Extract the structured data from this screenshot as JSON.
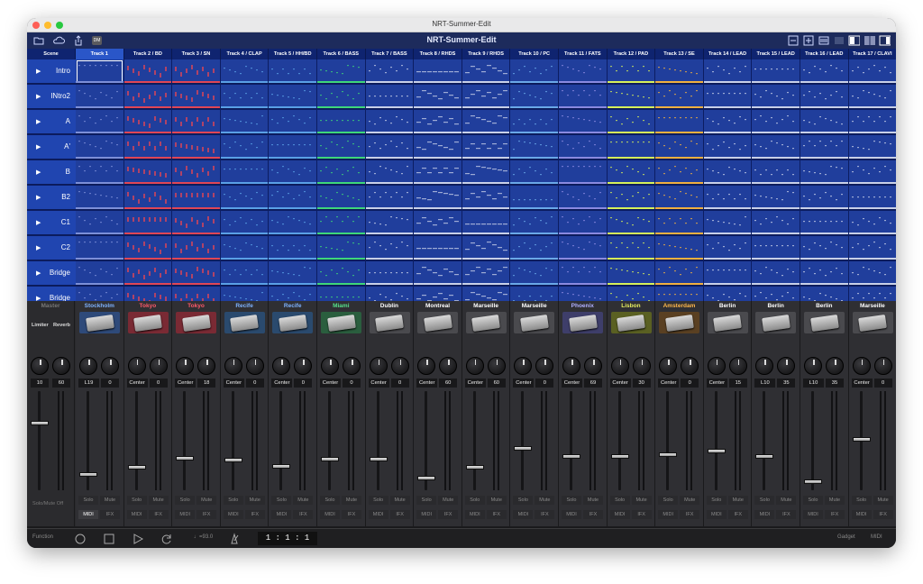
{
  "window": {
    "title": "NRT-Summer-Edit"
  },
  "toolbar": {
    "title": "NRT-Summer-Edit",
    "badge": "DM"
  },
  "header": {
    "scene_label": "Scene"
  },
  "tracks": [
    {
      "label": "Track 1",
      "color": "#7c8fd8"
    },
    {
      "label": "Track 2 / BD",
      "color": "#e04656"
    },
    {
      "label": "Track 3 / SN",
      "color": "#e04656"
    },
    {
      "label": "Track 4 / CLAP",
      "color": "#5aa0e6"
    },
    {
      "label": "Track 5 / HH/BD",
      "color": "#5aa0e6"
    },
    {
      "label": "Track 6 / BASS",
      "color": "#3ed77a"
    },
    {
      "label": "Track 7 / BASS",
      "color": "#c8d0e8"
    },
    {
      "label": "Track 8 / RHDS",
      "color": "#c8d0e8"
    },
    {
      "label": "Track 9 / RHDS",
      "color": "#c8d0e8"
    },
    {
      "label": "Track 10 / PC",
      "color": "#6aa8e8"
    },
    {
      "label": "Track 11 / FATS",
      "color": "#8a8ae0"
    },
    {
      "label": "Track 12 / PAD",
      "color": "#d6f05a"
    },
    {
      "label": "Track 13 / SE",
      "color": "#f0b040"
    },
    {
      "label": "Track 14 / LEAD",
      "color": "#c8d0e8"
    },
    {
      "label": "Track 15 / LEAD",
      "color": "#c8d0e8"
    },
    {
      "label": "Track 16 / LEAD",
      "color": "#c8d0e8"
    },
    {
      "label": "Track 17 / CLAVI",
      "color": "#c8d0e8"
    }
  ],
  "scenes": [
    "Intro",
    "INtro2",
    "A",
    "A'",
    "B",
    "B2",
    "C1",
    "C2",
    "Bridge",
    "Bridge"
  ],
  "mixer": {
    "master": {
      "label": "Master",
      "limiter": "Limiter",
      "reverb": "Reverb",
      "values": [
        "10",
        "60"
      ],
      "solo_mute_off": "Solo/Mute Off",
      "level": 0.68
    },
    "channels": [
      {
        "name": "Stockholm",
        "color": "#7fb3ff",
        "inst_bg": "#2e4a7a",
        "pan": "L19",
        "send": "0",
        "level": 0.16
      },
      {
        "name": "Tokyo",
        "color": "#ff5a6a",
        "inst_bg": "#7a2a34",
        "pan": "Center",
        "send": "0",
        "level": 0.24
      },
      {
        "name": "Tokyo",
        "color": "#ff5a6a",
        "inst_bg": "#7a2a34",
        "pan": "Center",
        "send": "18",
        "level": 0.33
      },
      {
        "name": "Recife",
        "color": "#7fb3ff",
        "inst_bg": "#2a4a6e",
        "pan": "Center",
        "send": "0",
        "level": 0.31
      },
      {
        "name": "Recife",
        "color": "#7fb3ff",
        "inst_bg": "#2a4a6e",
        "pan": "Center",
        "send": "0",
        "level": 0.25
      },
      {
        "name": "Miami",
        "color": "#56e08a",
        "inst_bg": "#2a5e3e",
        "pan": "Center",
        "send": "0",
        "level": 0.32
      },
      {
        "name": "Dublin",
        "color": "#ffffff",
        "inst_bg": "#4a4a4e",
        "pan": "Center",
        "send": "0",
        "level": 0.32
      },
      {
        "name": "Montreal",
        "color": "#ffffff",
        "inst_bg": "#4a4a4e",
        "pan": "Center",
        "send": "60",
        "level": 0.13
      },
      {
        "name": "Marseille",
        "color": "#ffffff",
        "inst_bg": "#4a4a4e",
        "pan": "Center",
        "send": "60",
        "level": 0.24
      },
      {
        "name": "Marseille",
        "color": "#ffffff",
        "inst_bg": "#4a4a4e",
        "pan": "Center",
        "send": "0",
        "level": 0.43
      },
      {
        "name": "Phoenix",
        "color": "#b0b0ff",
        "inst_bg": "#3e3e6a",
        "pan": "Center",
        "send": "69",
        "level": 0.35
      },
      {
        "name": "Lisbon",
        "color": "#e8f060",
        "inst_bg": "#5a6022",
        "pan": "Center",
        "send": "30",
        "level": 0.35
      },
      {
        "name": "Amsterdam",
        "color": "#ffb84a",
        "inst_bg": "#5a4022",
        "pan": "Center",
        "send": "0",
        "level": 0.36
      },
      {
        "name": "Berlin",
        "color": "#ffffff",
        "inst_bg": "#4a4a4e",
        "pan": "Center",
        "send": "15",
        "level": 0.4
      },
      {
        "name": "Berlin",
        "color": "#ffffff",
        "inst_bg": "#4a4a4e",
        "pan": "L10",
        "send": "35",
        "level": 0.35
      },
      {
        "name": "Berlin",
        "color": "#ffffff",
        "inst_bg": "#4a4a4e",
        "pan": "L10",
        "send": "35",
        "level": 0.09
      },
      {
        "name": "Marseille",
        "color": "#ffffff",
        "inst_bg": "#4a4a4e",
        "pan": "Center",
        "send": "0",
        "level": 0.52
      }
    ],
    "solo": "Solo",
    "mute": "Mute",
    "midi": "MIDI",
    "ifx": "IFX"
  },
  "transport": {
    "function_label": "Function",
    "tempo": "♩=93.0",
    "position": "1 :   1 :   1",
    "gadget": "Gadget",
    "midi": "MIDI"
  }
}
